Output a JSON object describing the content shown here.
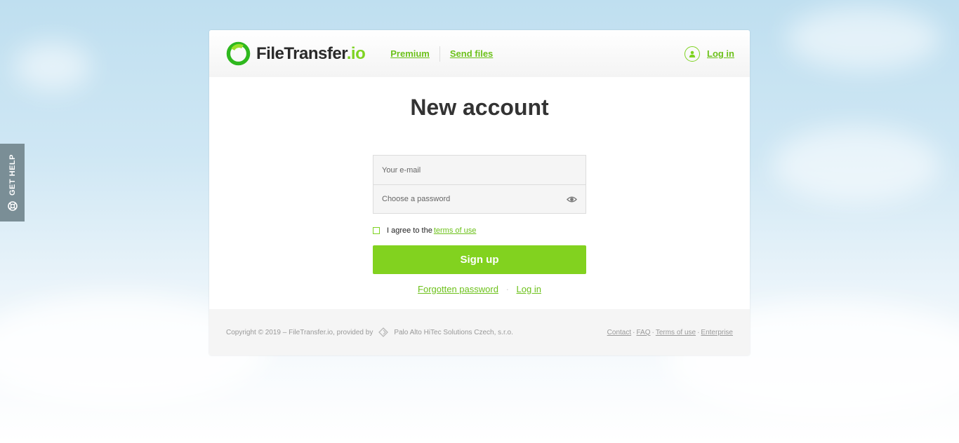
{
  "help_tab": {
    "label": "GET HELP",
    "icon": "lifebuoy-icon"
  },
  "header": {
    "logo_name": "FileTransfer",
    "logo_tld": ".io",
    "nav": [
      {
        "label": "Premium"
      },
      {
        "label": "Send files"
      }
    ],
    "login_label": "Log in"
  },
  "main": {
    "title": "New account",
    "email_placeholder": "Your e-mail",
    "password_placeholder": "Choose a password",
    "agree_text": "I agree to the",
    "terms_link": "terms of use",
    "signup_label": "Sign up",
    "forgot_label": "Forgotten password",
    "separator": "·",
    "login_label": "Log in"
  },
  "footer": {
    "copyright": "Copyright © 2019 – FileTransfer.io, provided by",
    "provider": "Palo Alto HiTec Solutions Czech, s.r.o.",
    "links": [
      "Contact",
      "FAQ",
      "Terms of use",
      "Enterprise"
    ],
    "link_separator": "·"
  },
  "colors": {
    "accent": "#82d21f",
    "link": "#6cc11a",
    "help_tab": "#7a8e96"
  }
}
